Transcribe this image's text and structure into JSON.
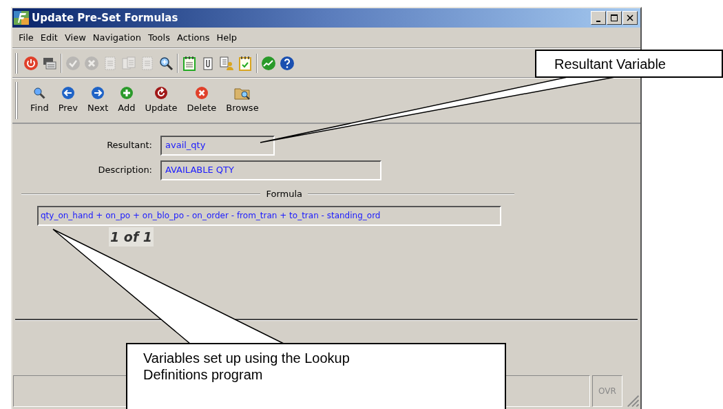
{
  "window": {
    "title": "Update Pre-Set Formulas"
  },
  "menu": [
    {
      "label": "File"
    },
    {
      "label": "Edit"
    },
    {
      "label": "View"
    },
    {
      "label": "Navigation"
    },
    {
      "label": "Tools"
    },
    {
      "label": "Actions"
    },
    {
      "label": "Help"
    }
  ],
  "toolbar": [
    {
      "kind": "power",
      "disabled": false
    },
    {
      "kind": "printer",
      "disabled": false
    },
    {
      "kind": "separator"
    },
    {
      "kind": "check",
      "disabled": true
    },
    {
      "kind": "cancel",
      "disabled": true
    },
    {
      "kind": "page",
      "disabled": true
    },
    {
      "kind": "pages",
      "disabled": true
    },
    {
      "kind": "page",
      "disabled": true
    },
    {
      "kind": "zoom",
      "disabled": false
    },
    {
      "kind": "separator"
    },
    {
      "kind": "notepad",
      "disabled": false
    },
    {
      "kind": "clip",
      "disabled": false
    },
    {
      "kind": "user",
      "disabled": false
    },
    {
      "kind": "calendar",
      "disabled": false
    },
    {
      "kind": "separator"
    },
    {
      "kind": "chart",
      "disabled": false
    },
    {
      "kind": "help",
      "disabled": false
    }
  ],
  "nav_buttons": [
    {
      "label": "Find",
      "kind": "find"
    },
    {
      "label": "Prev",
      "kind": "prev"
    },
    {
      "label": "Next",
      "kind": "next"
    },
    {
      "label": "Add",
      "kind": "add"
    },
    {
      "label": "Update",
      "kind": "update"
    },
    {
      "label": "Delete",
      "kind": "delete"
    },
    {
      "label": "Browse",
      "kind": "browse"
    }
  ],
  "fields": [
    {
      "label": "Resultant:",
      "value": "avail_qty"
    },
    {
      "label": "Description:",
      "value": "AVAILABLE QTY"
    }
  ],
  "formula": {
    "heading": "Formula",
    "value": "qty_on_hand + on_po + on_blo_po - on_order - from_tran + to_tran - standing_ord",
    "record_counter": "1 of 1"
  },
  "status_bar": {
    "mode": "OVR"
  },
  "callouts": [
    {
      "text": "Resultant Variable"
    },
    {
      "text": "Variables set up using the Lookup Definitions program"
    }
  ]
}
